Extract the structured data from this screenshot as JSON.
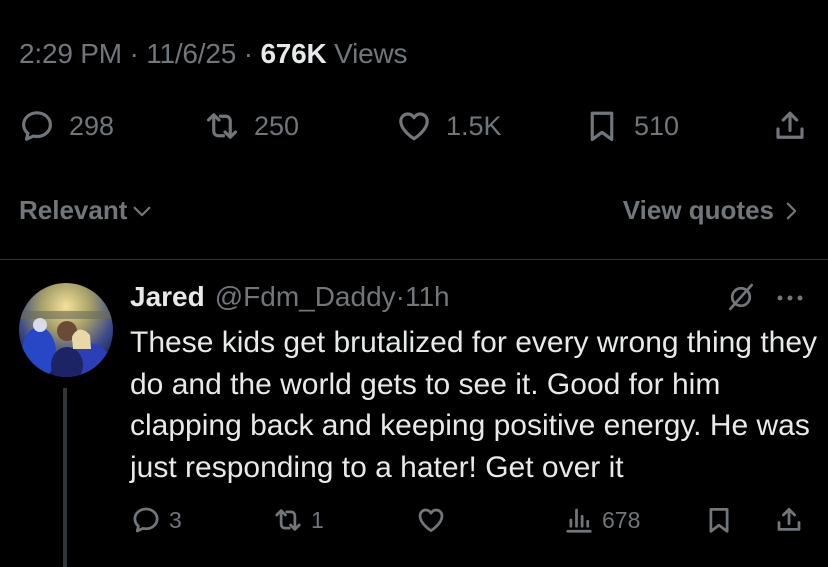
{
  "post_meta": {
    "time": "2:29 PM",
    "sep1": " · ",
    "date": "11/6/25",
    "sep2": " · ",
    "views_count": "676K",
    "views_label": " Views"
  },
  "post_actions": {
    "replies": "298",
    "reposts": "250",
    "likes": "1.5K",
    "bookmarks": "510"
  },
  "sort_bar": {
    "sort_label": "Relevant",
    "quotes_label": "View quotes"
  },
  "reply": {
    "name": "Jared",
    "handle": "@Fdm_Daddy",
    "separator": " · ",
    "time": "11h",
    "text": "These kids get brutalized for every wrong thing they do and the world gets to see it. Good for him clapping back and keeping positive energy. He was just responding to a hater! Get over it",
    "replies": "3",
    "reposts": "1",
    "likes": "",
    "views": "678"
  },
  "colors": {
    "background": "#000000",
    "text_primary": "#e7e9ea",
    "text_secondary": "#71767b",
    "divider": "#2f3336"
  },
  "icons": [
    "reply-icon",
    "repost-icon",
    "like-icon",
    "bookmark-icon",
    "share-icon",
    "chevron-down-icon",
    "chevron-right-icon",
    "grok-icon",
    "more-icon",
    "views-icon"
  ]
}
